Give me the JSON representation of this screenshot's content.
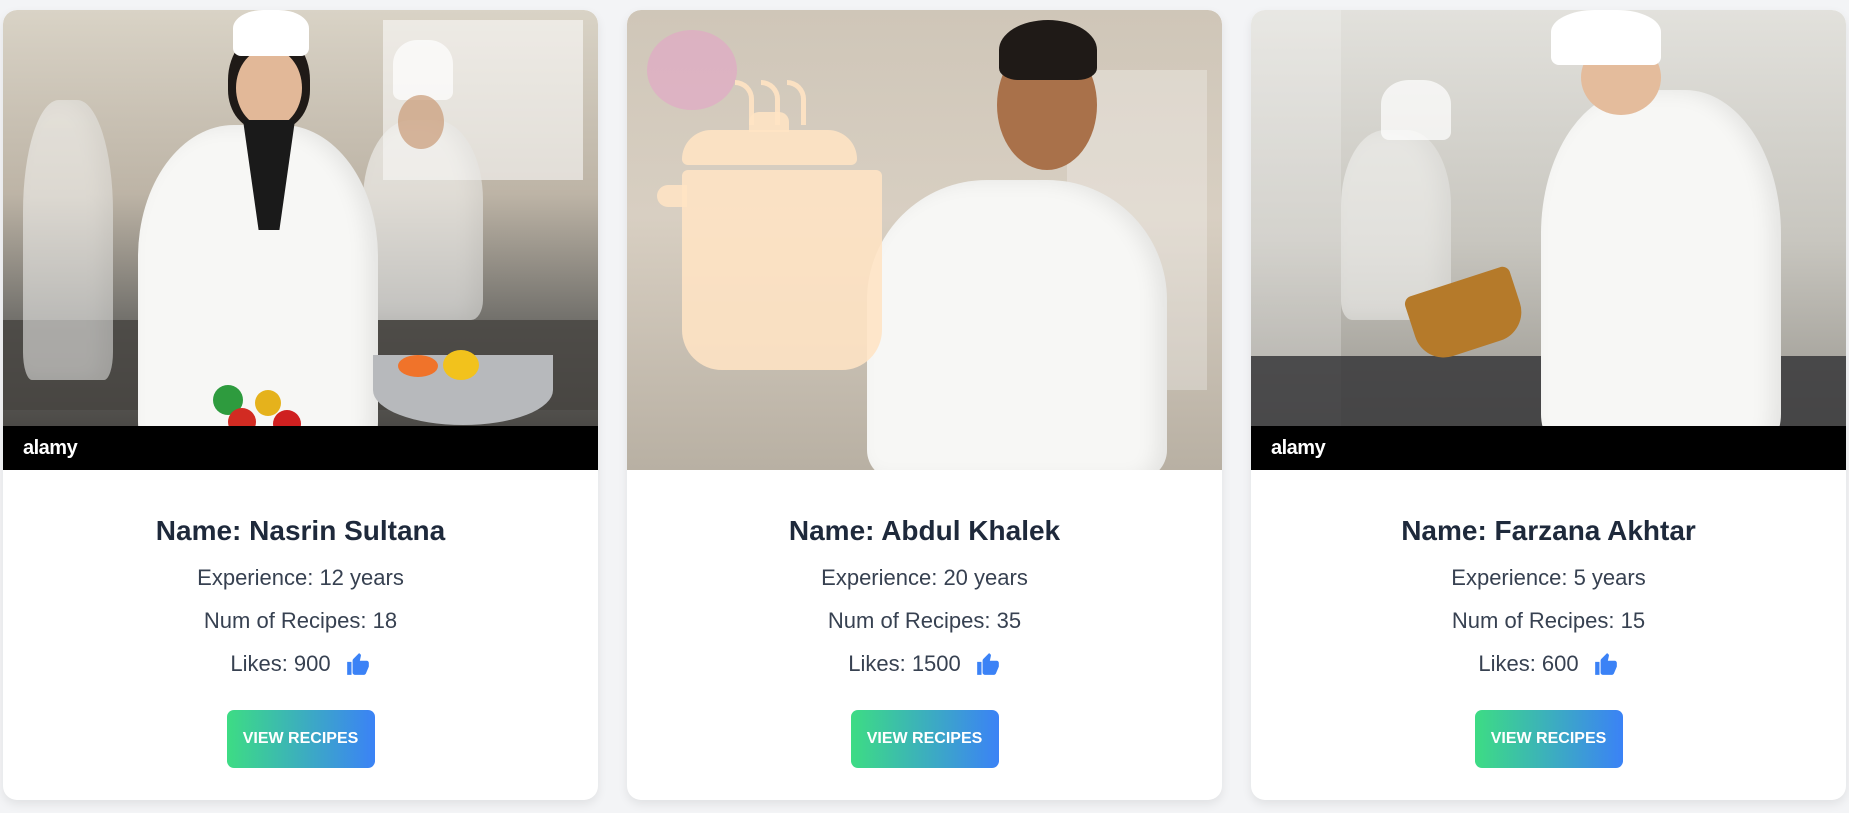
{
  "chefs": [
    {
      "name": "Name: Nasrin Sultana",
      "experience": "Experience: 12 years",
      "recipes": "Num of Recipes: 18",
      "likes": "Likes: 900",
      "button": "VIEW RECIPES",
      "watermark": "alamy"
    },
    {
      "name": "Name: Abdul Khalek",
      "experience": "Experience: 20 years",
      "recipes": "Num of Recipes: 35",
      "likes": "Likes: 1500",
      "button": "VIEW RECIPES",
      "watermark": ""
    },
    {
      "name": "Name: Farzana Akhtar",
      "experience": "Experience: 5 years",
      "recipes": "Num of Recipes: 15",
      "likes": "Likes: 600",
      "button": "VIEW RECIPES",
      "watermark": "alamy"
    }
  ],
  "icons": {
    "like": "thumbs-up-icon"
  },
  "colors": {
    "button_gradient_start": "#3ddc84",
    "button_gradient_end": "#3b82f6",
    "like_icon": "#3b82f6"
  }
}
